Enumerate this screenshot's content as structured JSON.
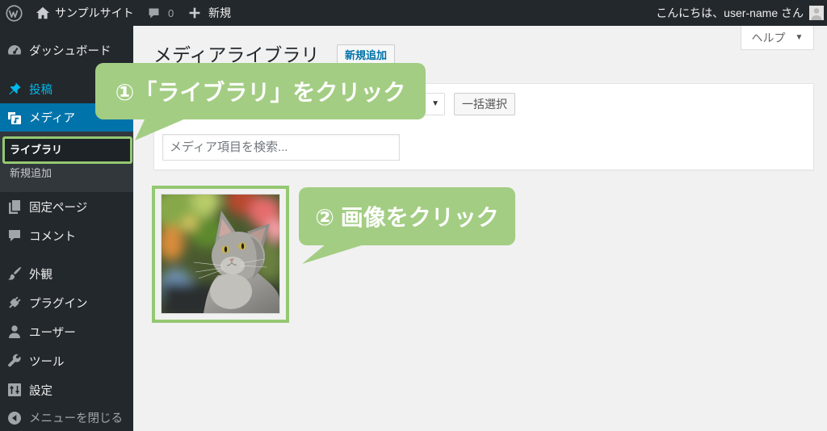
{
  "admin_bar": {
    "logo_icon": "wordpress-logo-icon",
    "site_icon": "home-icon",
    "site_name": "サンプルサイト",
    "comments_icon": "comment-icon",
    "comments_count": "0",
    "new_icon": "plus-icon",
    "new_label": "新規",
    "greeting": "こんにちは、user-name さん",
    "avatar_icon": "user-avatar-icon"
  },
  "sidebar": {
    "items": [
      {
        "label": "ダッシュボード",
        "icon": "dashboard-icon"
      },
      {
        "label": "投稿",
        "icon": "pushpin-icon",
        "hover": true
      },
      {
        "label": "メディア",
        "icon": "media-icon",
        "current": true
      },
      {
        "label": "固定ページ",
        "icon": "pages-icon"
      },
      {
        "label": "コメント",
        "icon": "comment-icon"
      },
      {
        "label": "外観",
        "icon": "paintbrush-icon"
      },
      {
        "label": "プラグイン",
        "icon": "plugin-icon"
      },
      {
        "label": "ユーザー",
        "icon": "user-icon"
      },
      {
        "label": "ツール",
        "icon": "wrench-icon"
      },
      {
        "label": "設定",
        "icon": "settings-icon"
      }
    ],
    "media_submenu": [
      {
        "label": "ライブラリ",
        "current": true
      },
      {
        "label": "新規追加"
      }
    ],
    "collapse": {
      "label": "メニューを閉じる",
      "icon": "collapse-arrow-icon"
    }
  },
  "help_tab": {
    "label": "ヘルプ",
    "arrow": "▼"
  },
  "page": {
    "title": "メディアライブラリ",
    "add_new_label": "新規追加"
  },
  "toolbar": {
    "filter_select_arrow": "▼",
    "bulk_select_label": "一括選択"
  },
  "search": {
    "placeholder": "メディア項目を検索..."
  },
  "callouts": [
    {
      "text": "①「ライブラリ」をクリック"
    },
    {
      "text": "② 画像をクリック"
    }
  ],
  "colors": {
    "admin_bar_bg": "#23282d",
    "menu_bg": "#23282d",
    "submenu_bg": "#32373c",
    "menu_active_bg": "#0073aa",
    "menu_hover_text": "#00b9eb",
    "content_bg": "#f1f1f1",
    "link_blue": "#0073aa",
    "callout_green": "#a3cd83",
    "highlight_green": "#94c872"
  }
}
